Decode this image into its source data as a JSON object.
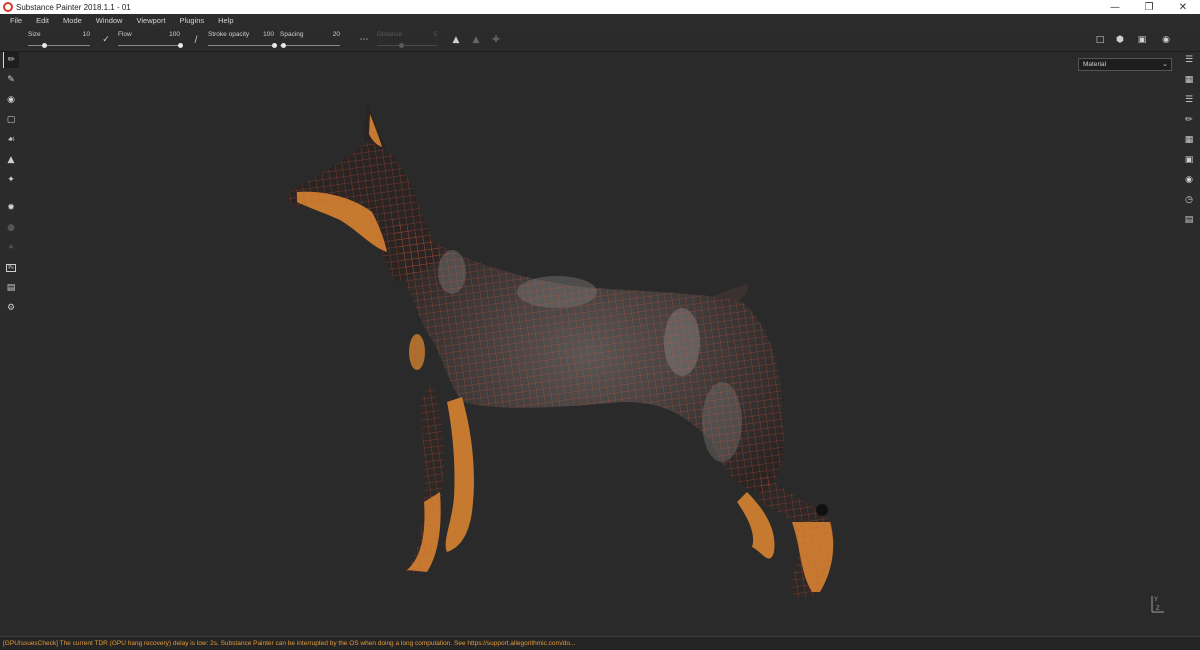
{
  "window": {
    "title": "Substance Painter 2018.1.1 - 01",
    "controls": [
      "minimize-icon",
      "restore-icon",
      "close-icon"
    ]
  },
  "menu": {
    "items": [
      "File",
      "Edit",
      "Mode",
      "Window",
      "Viewport",
      "Plugins",
      "Help"
    ]
  },
  "toolbar": {
    "size": {
      "label": "Size",
      "value": "10",
      "fraction": 0.25
    },
    "flow": {
      "label": "Flow",
      "value": "100",
      "fraction": 1.0
    },
    "stroke_opacity": {
      "label": "Stroke opacity",
      "value": "100",
      "fraction": 1.0
    },
    "spacing": {
      "label": "Spacing",
      "value": "20",
      "fraction": 0.05
    },
    "distance": {
      "label": "Distance",
      "value": "5",
      "fraction": 0.4
    },
    "icons": [
      "brush-icon",
      "slash-icon",
      "lazy-mouse-icon",
      "symmetry-icon",
      "mirror-icon",
      "pivot-icon",
      "view-2d-icon",
      "view-3d-icon",
      "camera-icon",
      "screenshot-icon"
    ]
  },
  "left_tools": [
    "paint-brush-icon",
    "eraser-icon",
    "projection-icon",
    "polygon-fill-icon",
    "smudge-icon",
    "clone-icon",
    "color-picker-icon",
    "bake-icon",
    "iray-icon",
    "sparkle-icon",
    "photoshop-icon",
    "export-icon",
    "settings-icon"
  ],
  "right_panels": [
    "layers-icon",
    "texture-set-icon",
    "stack-icon",
    "brush-settings-icon",
    "uv-icon",
    "display-icon",
    "shelf-icon",
    "history-icon",
    "log-icon"
  ],
  "viewport": {
    "channel": "Material",
    "axis": [
      "Y",
      "Z"
    ]
  },
  "status": {
    "message": "[GPUIssuesCheck] The current TDR (GPU hang recovery) delay is low: 2s. Substance Painter can be interrupted by the OS when doing a long computation. See https://support.allegorithmic.com/do..."
  },
  "colors": {
    "accent": "#e09a3c",
    "wire": "#d0553a",
    "coat": "#2e2826",
    "tan": "#c57a30"
  }
}
